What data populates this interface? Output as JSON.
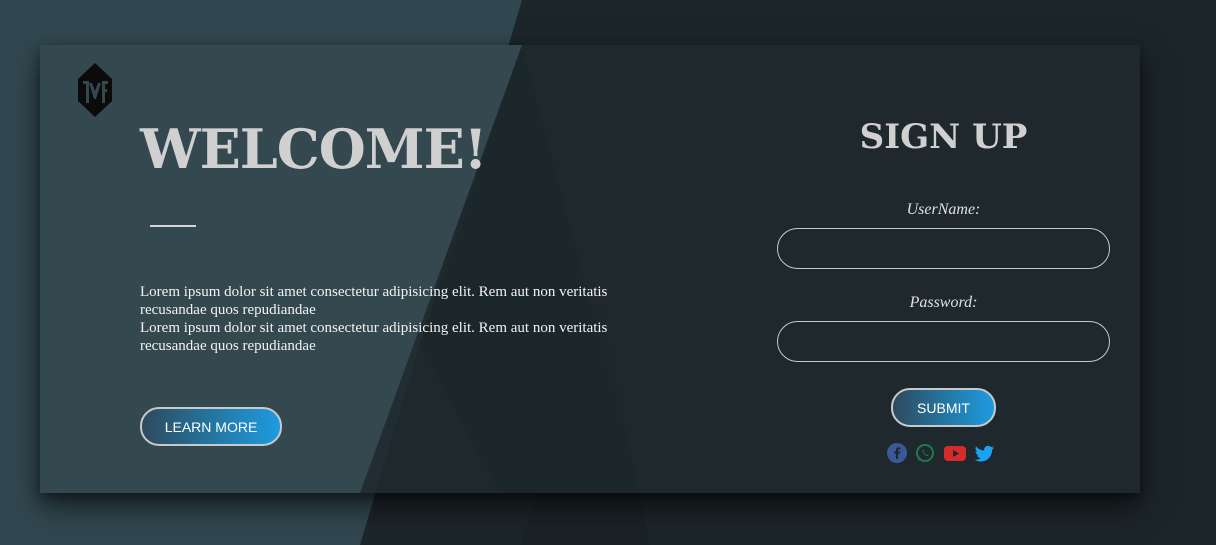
{
  "brand": {
    "logo_text": "TWF"
  },
  "hero": {
    "title": "WELCOME!",
    "paragraphs": [
      "Lorem ipsum dolor sit amet consectetur adipisicing elit. Rem aut non veritatis recusandae quos repudiandae",
      "Lorem ipsum dolor sit amet consectetur adipisicing elit. Rem aut non veritatis recusandae quos repudiandae"
    ],
    "cta_label": "LEARN MORE"
  },
  "signup": {
    "title": "SIGN UP",
    "username_label": "UserName:",
    "username_value": "",
    "password_label": "Password:",
    "password_value": "",
    "submit_label": "SUBMIT"
  },
  "social": [
    {
      "name": "facebook-icon",
      "color": "#3b5998"
    },
    {
      "name": "whatsapp-icon",
      "color": "#1f7a4a"
    },
    {
      "name": "youtube-icon",
      "color": "#d42b2b"
    },
    {
      "name": "twitter-icon",
      "color": "#1da1f2"
    }
  ],
  "colors": {
    "background": "#1d272c",
    "accent_gradient_start": "#2e4a5d",
    "accent_gradient_end": "#1e9be0",
    "title_text": "#d0d0d0"
  }
}
